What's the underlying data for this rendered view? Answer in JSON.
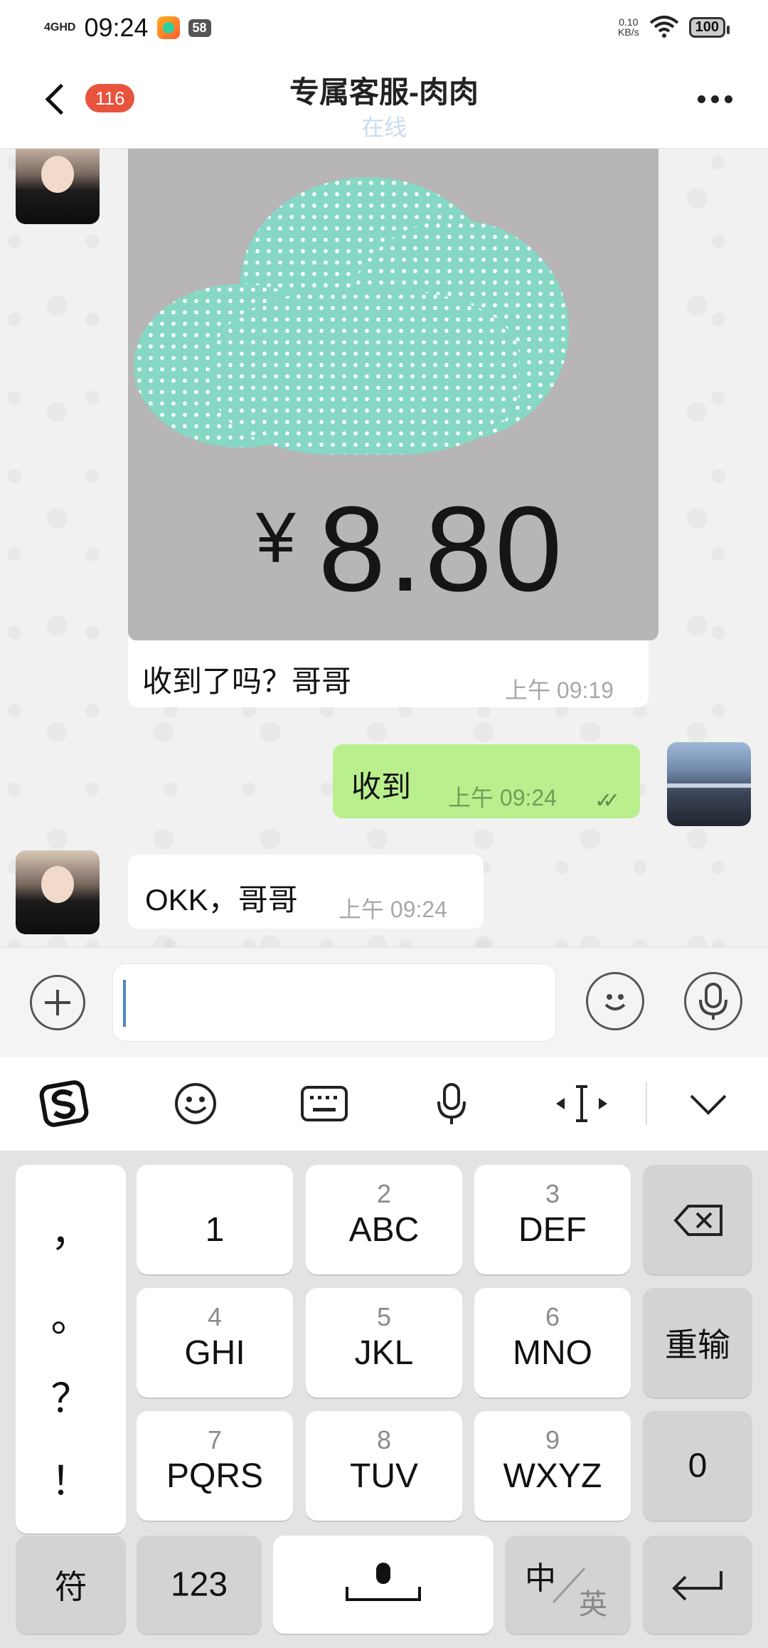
{
  "status_bar": {
    "network": "4GHD",
    "time": "09:24",
    "notification_count": "58",
    "net_speed_value": "0.10",
    "net_speed_unit": "KB/s",
    "battery": "100"
  },
  "header": {
    "unread_badge": "116",
    "title": "专属客服-肉肉",
    "status": "在线"
  },
  "messages": [
    {
      "price_symbol": "¥",
      "price_value": "8.80",
      "text": "收到了吗？哥哥",
      "time": "上午  09:19"
    },
    {
      "text": "收到",
      "time": "上午  09:24",
      "check": "✓✓"
    },
    {
      "text": "OKK，哥哥",
      "time": "上午  09:24"
    }
  ],
  "keyboard": {
    "punct": [
      "，",
      "。",
      "？",
      "！"
    ],
    "keys": [
      {
        "num": "",
        "label": "1"
      },
      {
        "num": "2",
        "label": "ABC"
      },
      {
        "num": "3",
        "label": "DEF"
      },
      {
        "num": "4",
        "label": "GHI"
      },
      {
        "num": "5",
        "label": "JKL"
      },
      {
        "num": "6",
        "label": "MNO"
      },
      {
        "num": "7",
        "label": "PQRS"
      },
      {
        "num": "8",
        "label": "TUV"
      },
      {
        "num": "9",
        "label": "WXYZ"
      }
    ],
    "reenter": "重输",
    "zero": "0",
    "symbols": "符",
    "numbers": "123",
    "lang_cn": "中",
    "lang_en": "英"
  }
}
